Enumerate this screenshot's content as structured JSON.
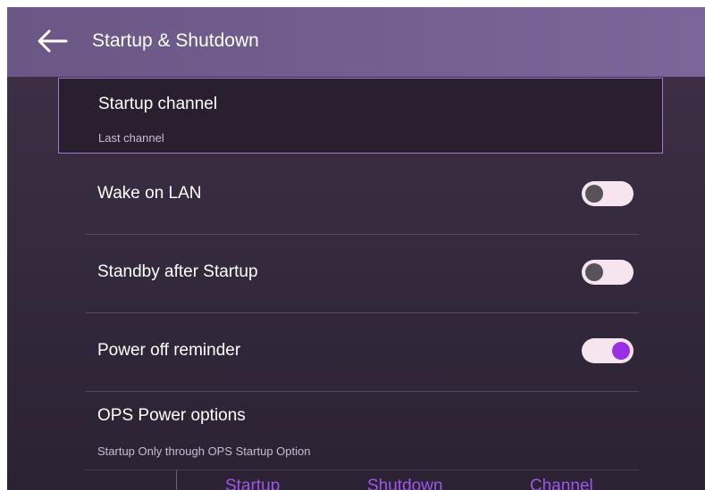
{
  "header": {
    "title": "Startup & Shutdown",
    "back_icon": "arrow-left-icon"
  },
  "startup_channel": {
    "title": "Startup channel",
    "value": "Last channel"
  },
  "settings": [
    {
      "label": "Wake on LAN",
      "enabled": false
    },
    {
      "label": "Standby after Startup",
      "enabled": false
    },
    {
      "label": "Power off reminder",
      "enabled": true
    }
  ],
  "ops": {
    "title": "OPS Power options",
    "subtitle": "Startup Only through OPS Startup Option",
    "columns": [
      "Startup",
      "Shutdown",
      "Channel"
    ]
  },
  "colors": {
    "header_bg": "#725f8e",
    "screen_bg": "#392c40",
    "highlight_border": "#a275d6",
    "toggle_on_knob": "#9b2fe6",
    "toggle_off_knob": "#58525c",
    "toggle_track": "#f6e4ef",
    "column_text": "#9b58e6"
  }
}
